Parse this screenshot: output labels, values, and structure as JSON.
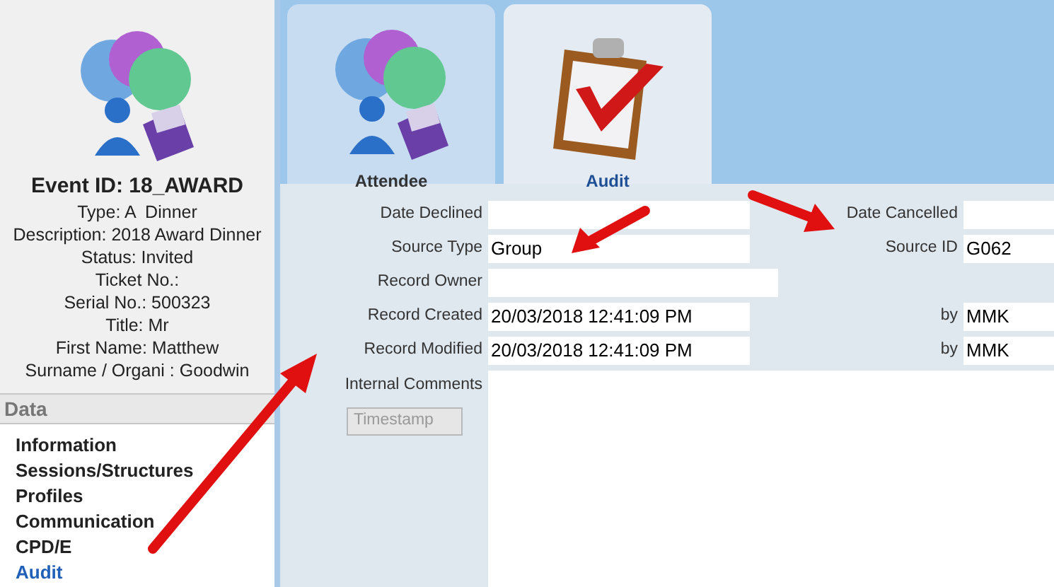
{
  "event_summary": {
    "heading": "Event ID: 18_AWARD",
    "lines": [
      "Type: A  Dinner",
      "Description: 2018 Award Dinner",
      "Status: Invited",
      "Ticket No.:",
      "Serial No.: 500323",
      "Title: Mr",
      "First Name: Matthew",
      "Surname / Organi : Goodwin"
    ]
  },
  "sidebar": {
    "header": "Data",
    "items": [
      {
        "label": "Information",
        "selected": false
      },
      {
        "label": "Sessions/Structures",
        "selected": false
      },
      {
        "label": "Profiles",
        "selected": false
      },
      {
        "label": "Communication",
        "selected": false
      },
      {
        "label": "CPD/E",
        "selected": false
      },
      {
        "label": "Audit",
        "selected": true
      }
    ]
  },
  "tabs": [
    {
      "label": "Attendee",
      "kind": "attendee",
      "selected": false
    },
    {
      "label": "Audit",
      "kind": "audit",
      "selected": true
    }
  ],
  "form": {
    "rows": [
      {
        "label": "Date Declined",
        "value": "",
        "right_label": "Date Cancelled",
        "right_value": ""
      },
      {
        "label": "Source Type",
        "value": "Group",
        "right_label": "Source ID",
        "right_value": "G062"
      },
      {
        "label": "Record Owner",
        "value": "",
        "wide": true
      },
      {
        "label": "Record Created",
        "value": "20/03/2018 12:41:09 PM",
        "right_label": "by",
        "right_value": "MMK"
      },
      {
        "label": "Record Modified",
        "value": "20/03/2018 12:41:09 PM",
        "right_label": "by",
        "right_value": "MMK"
      }
    ],
    "comments_label": "Internal Comments",
    "timestamp_button": {
      "label": "Timestamp",
      "disabled": true
    }
  }
}
